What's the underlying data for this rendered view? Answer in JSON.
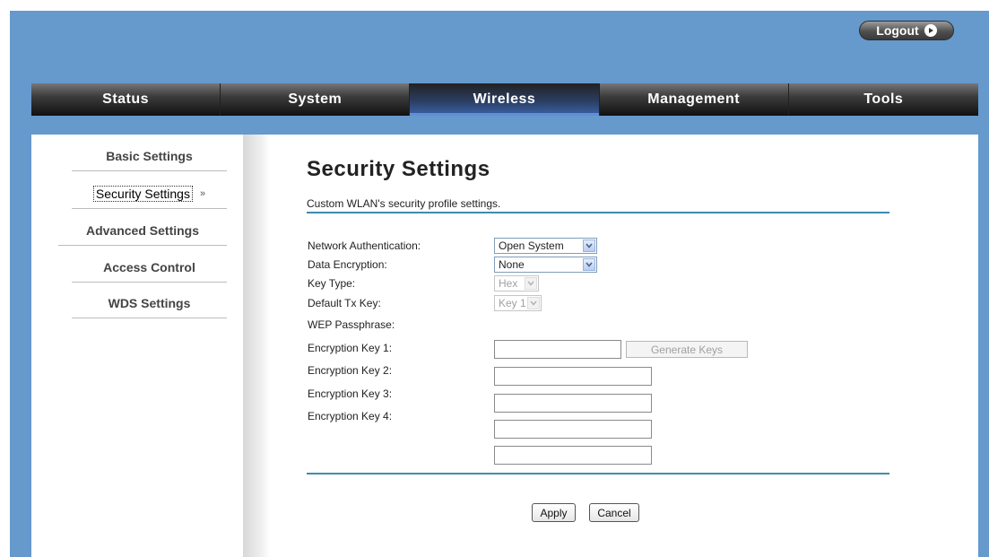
{
  "header": {
    "logout_label": "Logout"
  },
  "nav": {
    "tabs": [
      {
        "label": "Status"
      },
      {
        "label": "System"
      },
      {
        "label": "Wireless"
      },
      {
        "label": "Management"
      },
      {
        "label": "Tools"
      }
    ],
    "active": "Wireless"
  },
  "sidebar": {
    "items": [
      {
        "label": "Basic Settings"
      },
      {
        "label": "Security Settings"
      },
      {
        "label": "Advanced Settings"
      },
      {
        "label": "Access Control"
      },
      {
        "label": "WDS Settings"
      }
    ],
    "active_marker": "»"
  },
  "main": {
    "title": "Security Settings",
    "description": "Custom WLAN's security profile settings.",
    "fields": {
      "network_auth": {
        "label": "Network Authentication:",
        "value": "Open System"
      },
      "data_encryption": {
        "label": "Data Encryption:",
        "value": "None"
      },
      "key_type": {
        "label": "Key Type:",
        "value": "Hex"
      },
      "default_tx_key": {
        "label": "Default Tx Key:",
        "value": "Key 1"
      },
      "wep_passphrase": {
        "label": "WEP Passphrase:",
        "value": ""
      },
      "enc_key_1": {
        "label": "Encryption Key 1:",
        "value": ""
      },
      "enc_key_2": {
        "label": "Encryption Key 2:",
        "value": ""
      },
      "enc_key_3": {
        "label": "Encryption Key 3:",
        "value": ""
      },
      "enc_key_4": {
        "label": "Encryption Key 4:",
        "value": ""
      }
    },
    "generate_keys_label": "Generate Keys",
    "apply_label": "Apply",
    "cancel_label": "Cancel"
  },
  "colors": {
    "header_bg": "#6699cc",
    "rule": "#3c8dae",
    "active_tab_accent": "#3b64a8"
  }
}
